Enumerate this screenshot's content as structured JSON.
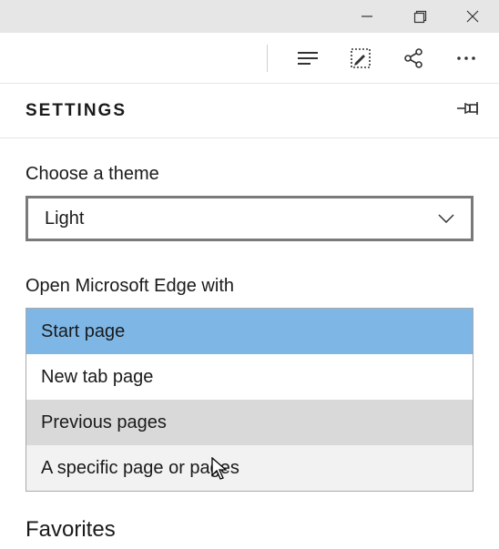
{
  "panel": {
    "title": "SETTINGS"
  },
  "theme": {
    "label": "Choose a theme",
    "value": "Light"
  },
  "openWith": {
    "label": "Open Microsoft Edge with",
    "options": [
      "Start page",
      "New tab page",
      "Previous pages",
      "A specific page or pages"
    ]
  },
  "next_section": "Favorites"
}
